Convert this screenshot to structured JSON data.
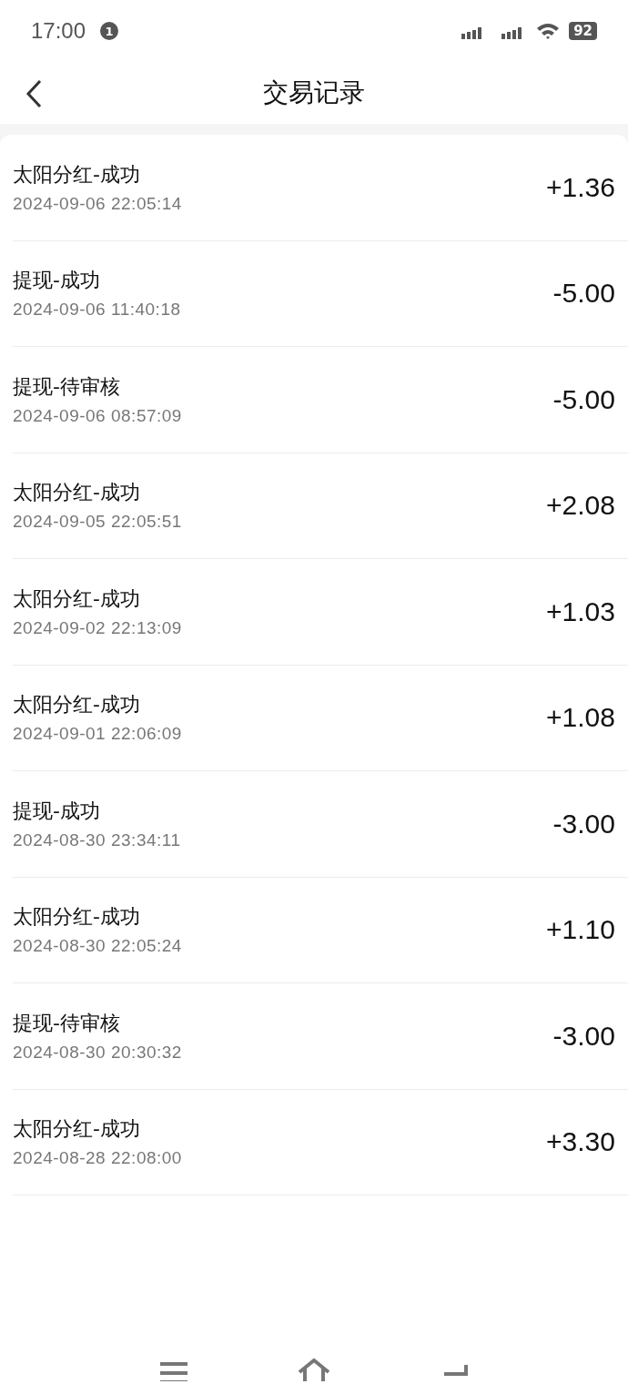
{
  "status_bar": {
    "time": "17:00",
    "notification_count": "1",
    "battery": "92"
  },
  "header": {
    "title": "交易记录"
  },
  "records": [
    {
      "title": "太阳分红-成功",
      "time": "2024-09-06 22:05:14",
      "amount": "+1.36"
    },
    {
      "title": "提现-成功",
      "time": "2024-09-06 11:40:18",
      "amount": "-5.00"
    },
    {
      "title": "提现-待审核",
      "time": "2024-09-06 08:57:09",
      "amount": "-5.00"
    },
    {
      "title": "太阳分红-成功",
      "time": "2024-09-05 22:05:51",
      "amount": "+2.08"
    },
    {
      "title": "太阳分红-成功",
      "time": "2024-09-02 22:13:09",
      "amount": "+1.03"
    },
    {
      "title": "太阳分红-成功",
      "time": "2024-09-01 22:06:09",
      "amount": "+1.08"
    },
    {
      "title": "提现-成功",
      "time": "2024-08-30 23:34:11",
      "amount": "-3.00"
    },
    {
      "title": "太阳分红-成功",
      "time": "2024-08-30 22:05:24",
      "amount": "+1.10"
    },
    {
      "title": "提现-待审核",
      "time": "2024-08-30 20:30:32",
      "amount": "-3.00"
    },
    {
      "title": "太阳分红-成功",
      "time": "2024-08-28 22:08:00",
      "amount": "+3.30"
    }
  ]
}
